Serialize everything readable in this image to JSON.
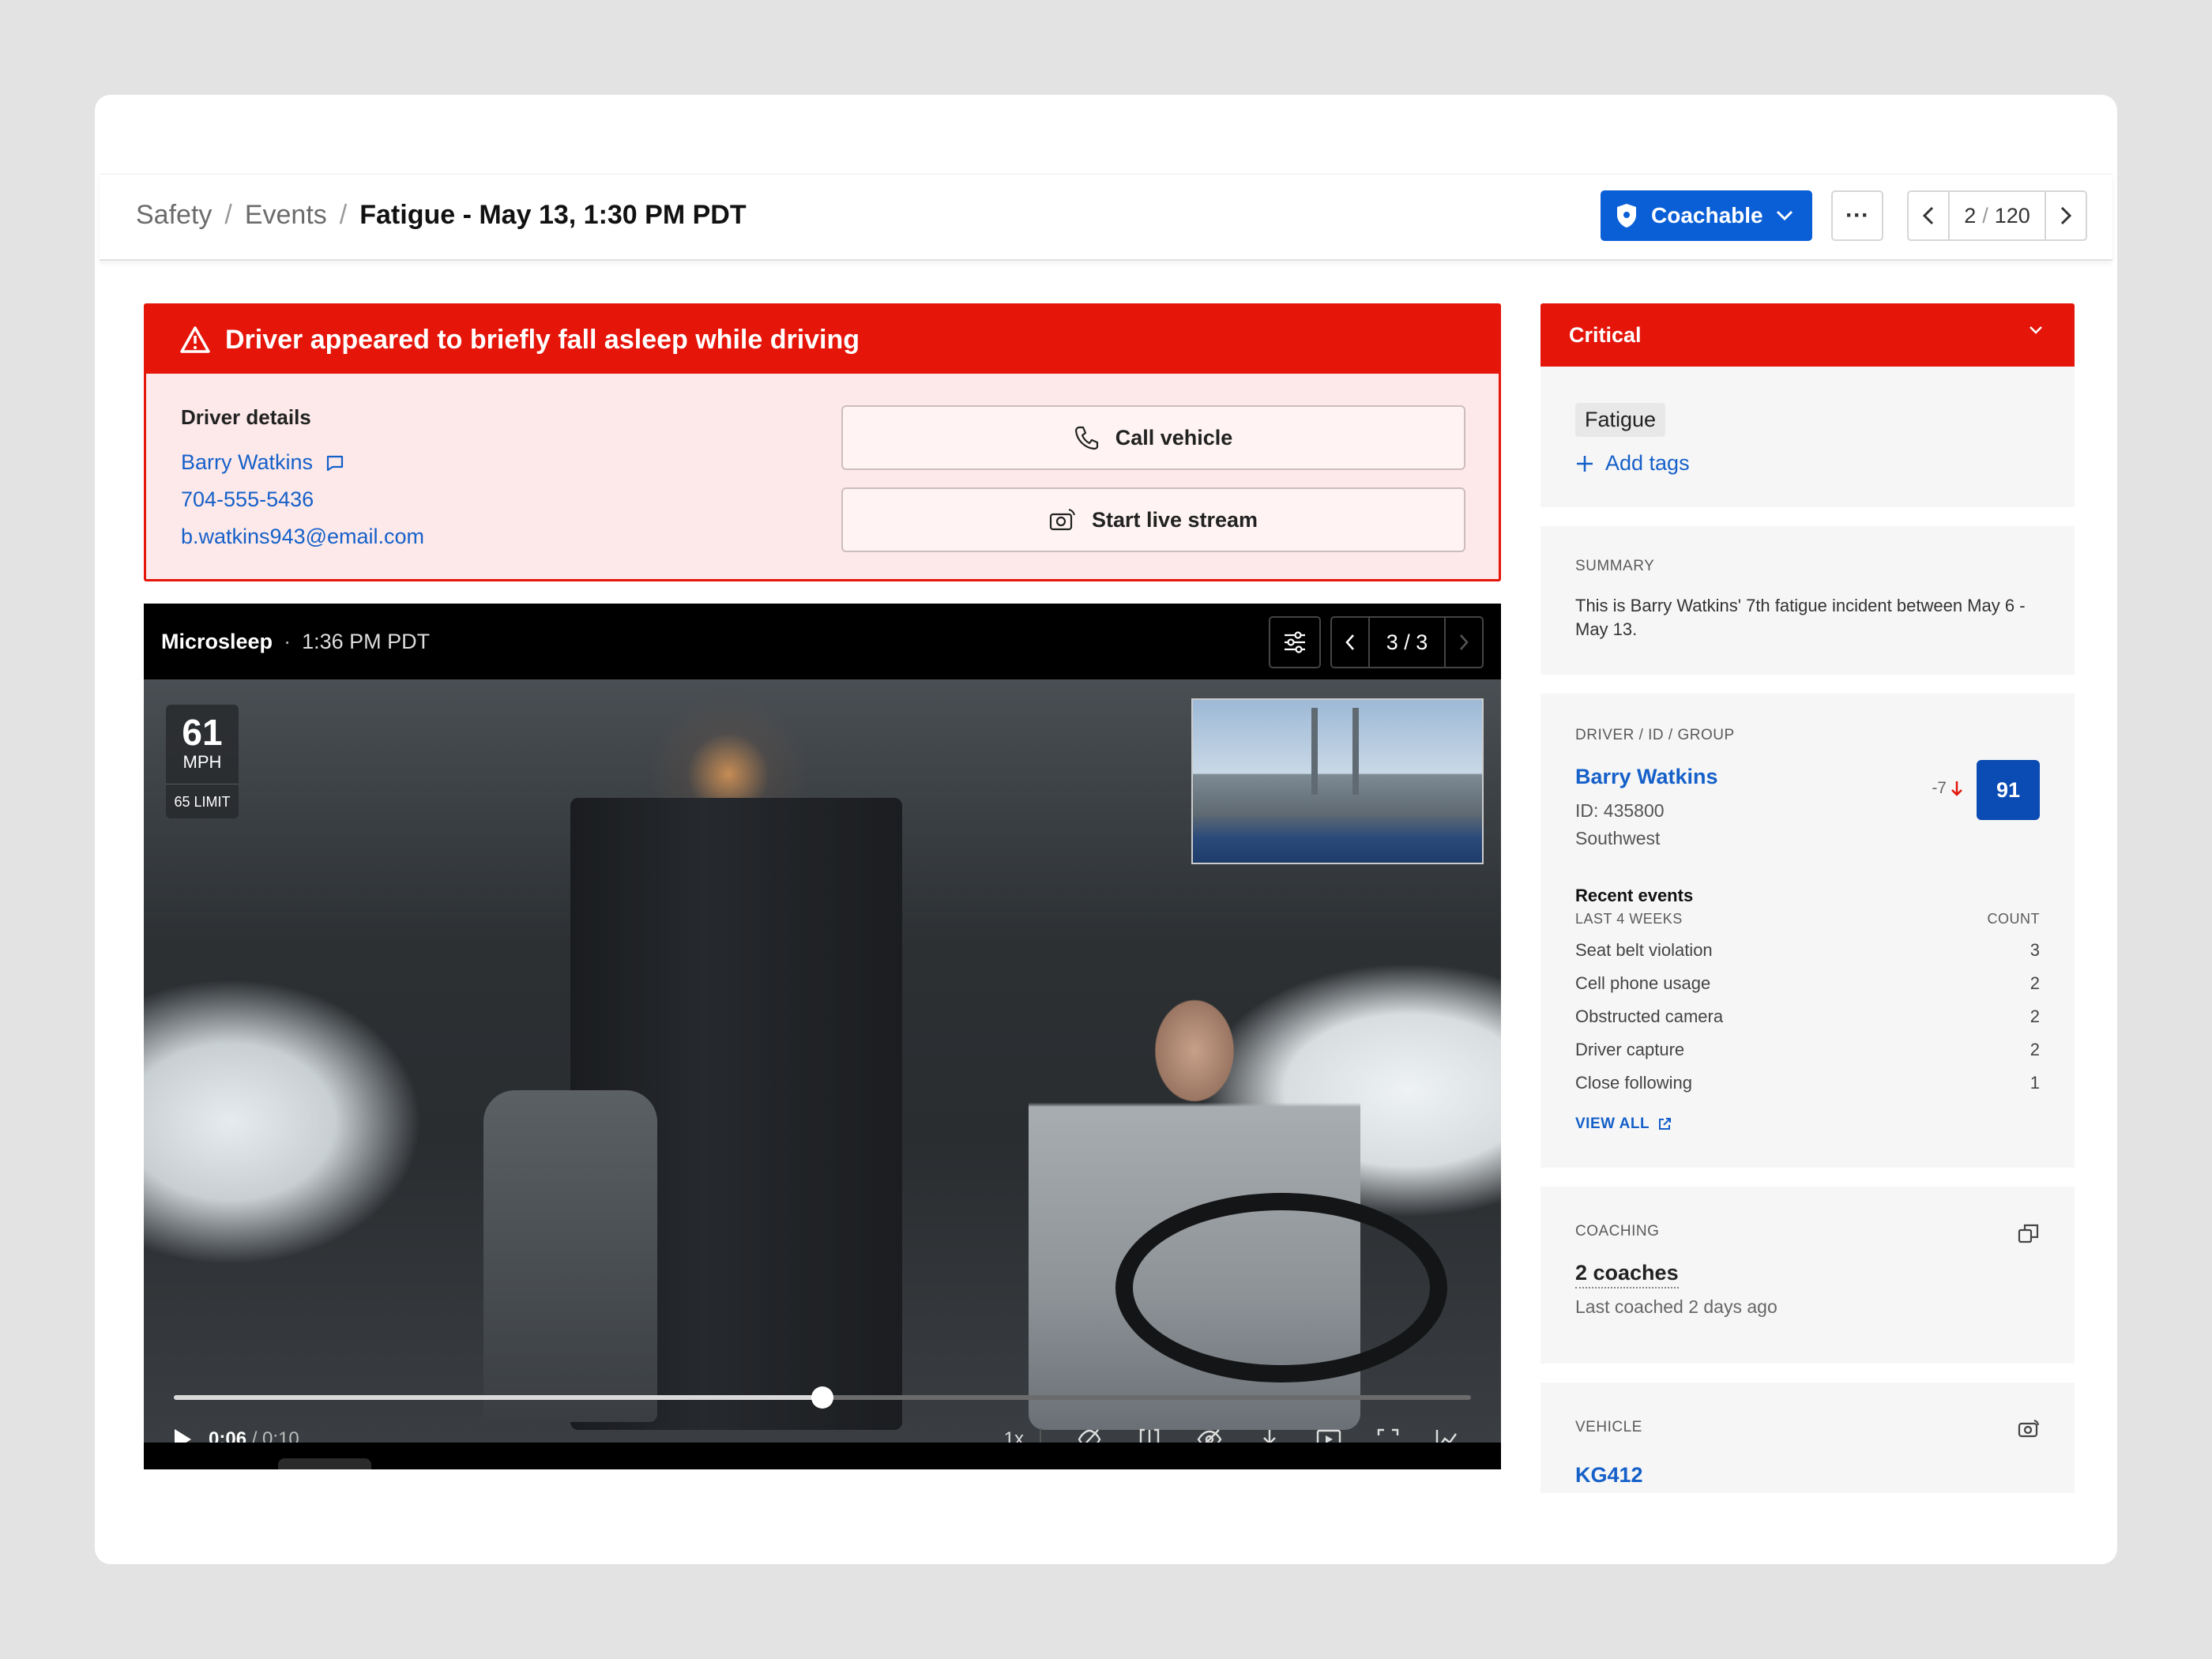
{
  "breadcrumb": {
    "items": [
      "Safety",
      "Events"
    ],
    "separator": "/",
    "current": "Fatigue - May 13, 1:30 PM PDT"
  },
  "header": {
    "coachable_label": "Coachable",
    "more_label": "···",
    "pager": {
      "current": "2",
      "separator": "/",
      "total": "120"
    }
  },
  "alert": {
    "title": "Driver appeared to briefly fall asleep while driving",
    "driver_details_label": "Driver details",
    "driver_name": "Barry Watkins",
    "phone": "704-555-5436",
    "email": "b.watkins943@email.com",
    "call_vehicle_label": "Call vehicle",
    "live_stream_label": "Start live stream"
  },
  "video": {
    "event_type": "Microsleep",
    "separator": "·",
    "time": "1:36 PM PDT",
    "clip_counter": "3 / 3",
    "speed": "61",
    "speed_unit": "MPH",
    "speed_limit": "65 LIMIT",
    "current_time": "0:06",
    "duration": "/ 0:10",
    "progress": 0.5,
    "playback_rate": "1x",
    "telemetry_speed": "61",
    "telemetry_limit": "65"
  },
  "panel": {
    "severity": "Critical",
    "tag": "Fatigue",
    "add_tags_label": "Add tags",
    "summary_label": "SUMMARY",
    "summary_text": "This is Barry Watkins' 7th fatigue incident between May 6 - May 13.",
    "driver_section_label": "DRIVER / ID / GROUP",
    "driver_name": "Barry Watkins",
    "driver_id": "ID: 435800",
    "driver_group": "Southwest",
    "score_delta": "-7",
    "score": "91",
    "recent_events_title": "Recent events",
    "recent_events_period": "LAST 4 WEEKS",
    "recent_events_count_label": "COUNT",
    "recent_events": [
      {
        "name": "Seat belt violation",
        "count": "3"
      },
      {
        "name": "Cell phone usage",
        "count": "2"
      },
      {
        "name": "Obstructed camera",
        "count": "2"
      },
      {
        "name": "Driver capture",
        "count": "2"
      },
      {
        "name": "Close following",
        "count": "1"
      }
    ],
    "view_all_label": "VIEW ALL",
    "coaching_label": "COACHING",
    "coaching_count": "2 coaches",
    "coaching_last": "Last coached 2 days ago",
    "vehicle_label": "VEHICLE",
    "vehicle_name": "KG412"
  },
  "colors": {
    "critical_red": "#e5150a",
    "brand_blue": "#0a5fd6",
    "link_blue": "#1560c9",
    "score_blue": "#0a4bb4"
  }
}
